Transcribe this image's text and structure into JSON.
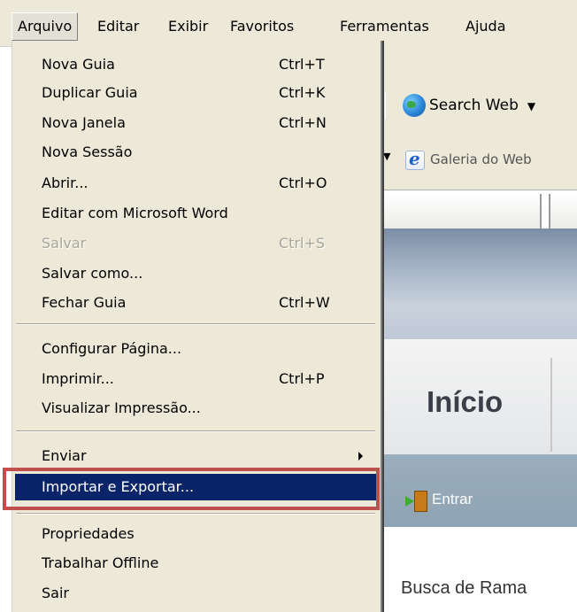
{
  "menubar": {
    "items": [
      {
        "label": "Arquivo",
        "active": true
      },
      {
        "label": "Editar"
      },
      {
        "label": "Exibir"
      },
      {
        "label": "Favoritos"
      },
      {
        "label": "Ferramentas"
      },
      {
        "label": "Ajuda"
      }
    ]
  },
  "file_menu": {
    "items": [
      {
        "label": "Nova Guia",
        "shortcut": "Ctrl+T"
      },
      {
        "label": "Duplicar Guia",
        "shortcut": "Ctrl+K"
      },
      {
        "label": "Nova Janela",
        "shortcut": "Ctrl+N"
      },
      {
        "label": "Nova Sessão",
        "shortcut": ""
      },
      {
        "label": "Abrir...",
        "shortcut": "Ctrl+O"
      },
      {
        "label": "Editar com Microsoft Word",
        "shortcut": ""
      },
      {
        "label": "Salvar",
        "shortcut": "Ctrl+S",
        "disabled": true
      },
      {
        "label": "Salvar como...",
        "shortcut": ""
      },
      {
        "label": "Fechar Guia",
        "shortcut": "Ctrl+W"
      },
      {
        "label": "Configurar Página...",
        "shortcut": ""
      },
      {
        "label": "Imprimir...",
        "shortcut": "Ctrl+P"
      },
      {
        "label": "Visualizar Impressão...",
        "shortcut": ""
      },
      {
        "label": "Enviar",
        "shortcut": "",
        "submenu": true
      },
      {
        "label": "Importar e Exportar...",
        "shortcut": "",
        "highlighted": true
      },
      {
        "label": "Propriedades",
        "shortcut": ""
      },
      {
        "label": "Trabalhar Offline",
        "shortcut": ""
      },
      {
        "label": "Sair",
        "shortcut": ""
      }
    ]
  },
  "background": {
    "search_label": "Search Web",
    "search_icon": "globe-icon",
    "favorites_link": "Galeria do Web",
    "nav_title": "Início",
    "login_label": "Entrar",
    "login_icon": "door-enter-icon",
    "content_heading": "Busca de Rama"
  },
  "colors": {
    "menu_bg": "#ece9d8",
    "highlight_bg": "#0a246a",
    "callout_border": "#c0504d"
  }
}
